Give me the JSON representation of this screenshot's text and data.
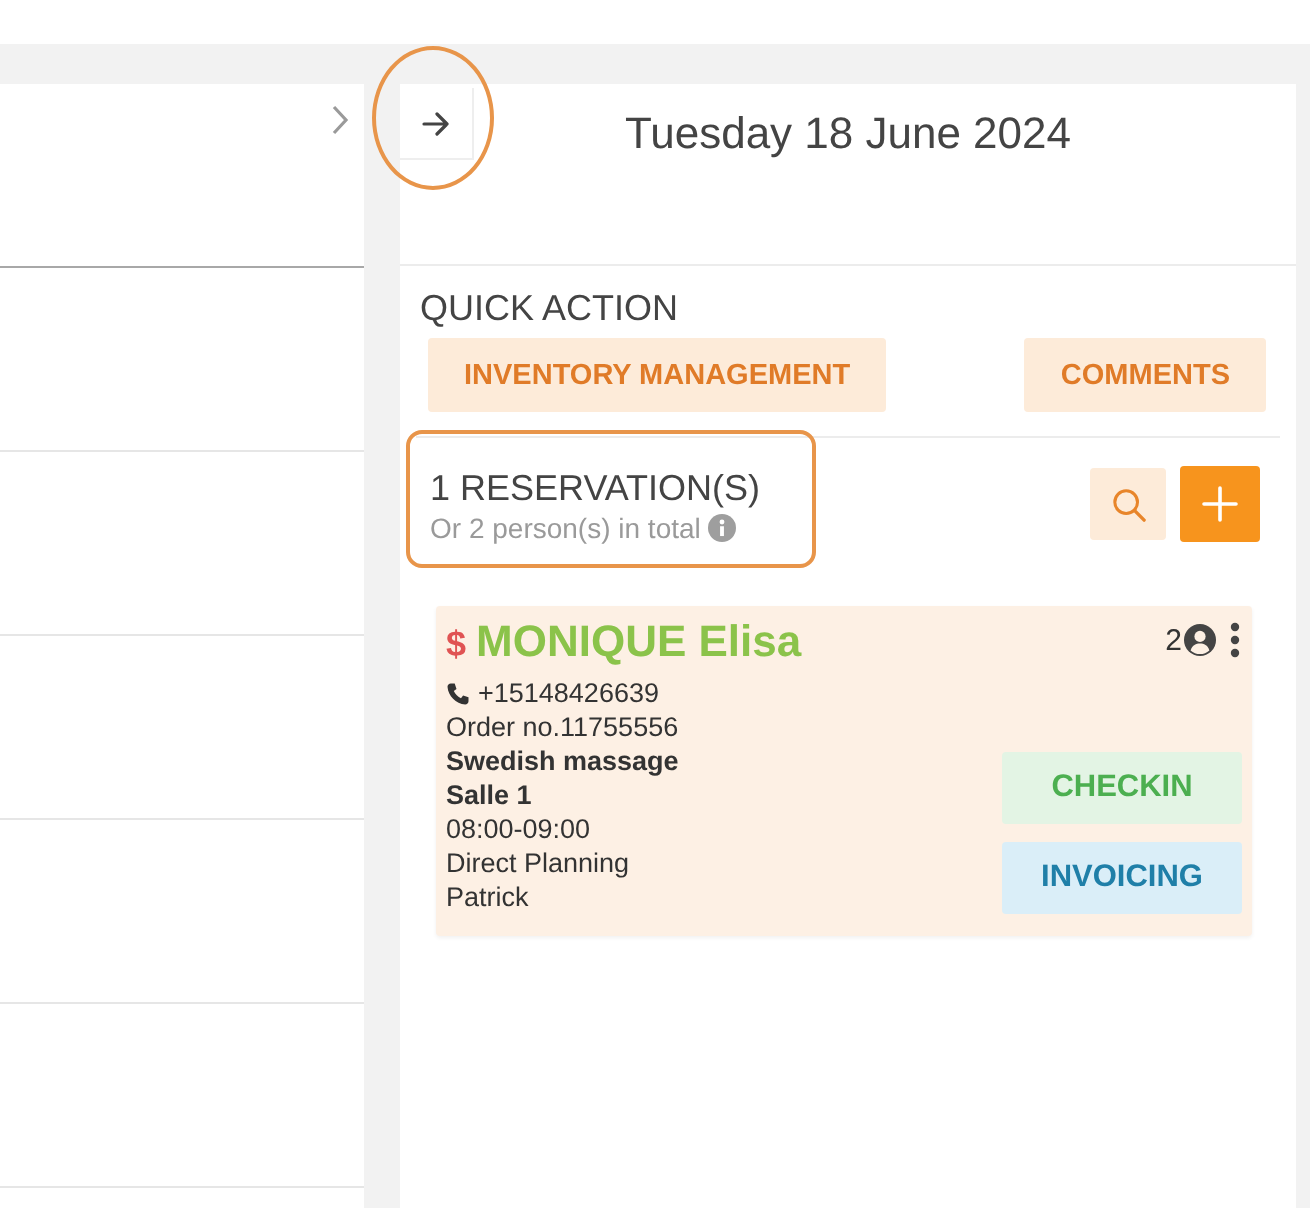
{
  "day_panel": {
    "toggle_button": {
      "highlighted": true
    },
    "date": "Tuesday 18 June 2024"
  },
  "quick_action": {
    "title": "QUICK ACTION",
    "buttons": [
      "INVENTORY MANAGEMENT",
      "COMMENTS"
    ]
  },
  "reservations": {
    "count": "1 RESERVATION(S)",
    "summary": "Or 2 person(s) in total",
    "highlighted": true
  },
  "bookings": [
    {
      "paid_marker": "$",
      "name": "MONIQUE Elisa",
      "persons": "2",
      "phone": "+15148426639",
      "order": "Order no.11755556",
      "service": "Swedish massage",
      "room": "Salle 1",
      "time": "08:00-09:00",
      "source": "Direct Planning",
      "staff": "Patrick",
      "actions": [
        {
          "label": "CHECKIN",
          "kind": "checkin"
        },
        {
          "label": "INVOICING",
          "kind": "invoicing"
        }
      ]
    }
  ]
}
